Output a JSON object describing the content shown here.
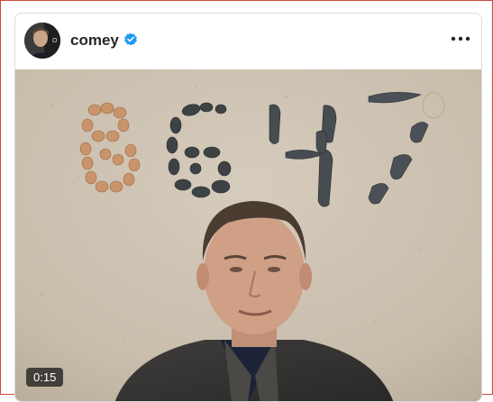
{
  "post": {
    "username": "comey",
    "verified": true,
    "avatar_icon": "profile-photo",
    "more_icon": "more-options-icon"
  },
  "media": {
    "type": "video",
    "duration": "0:15",
    "shell_digits": "8647"
  },
  "colors": {
    "verified_blue": "#1d9bf0",
    "sand": "#cfc4b4",
    "border_red": "#c94a3a"
  }
}
